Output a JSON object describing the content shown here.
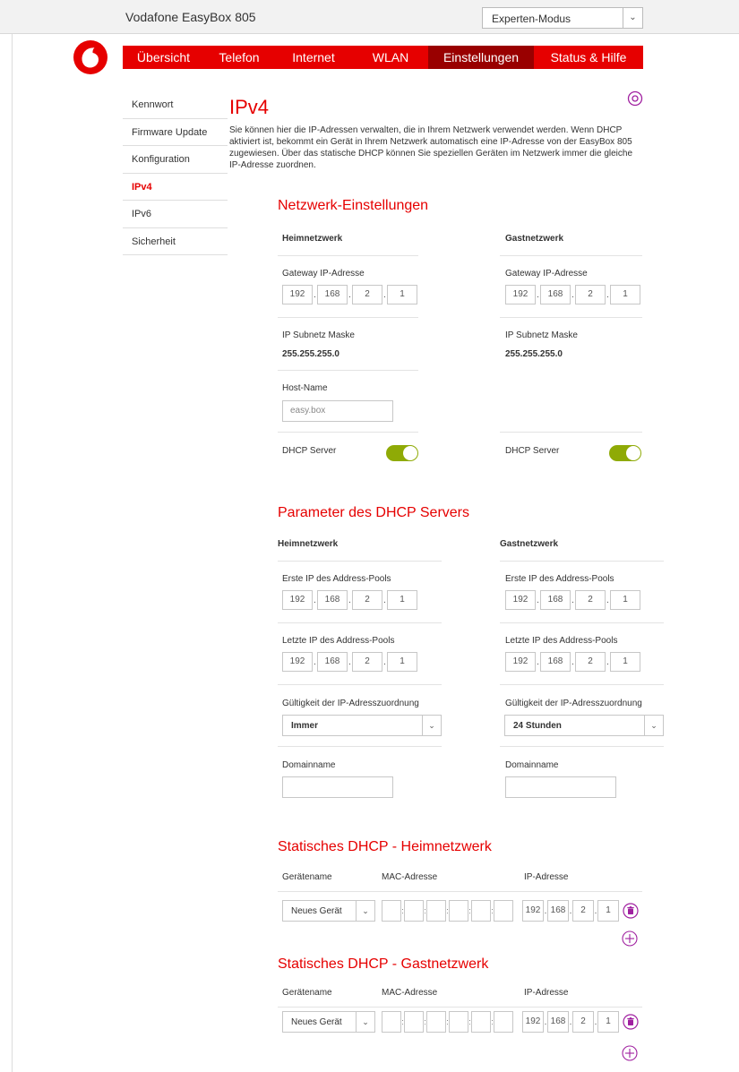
{
  "app": {
    "title": "Vodafone EasyBox 805"
  },
  "mode": {
    "selected": "Experten-Modus"
  },
  "colors": {
    "brand": "#e60000",
    "nav_active": "#990000",
    "toggle_on": "#8faa06",
    "accent_icon": "#a020a0"
  },
  "nav": {
    "items": [
      {
        "label": "Übersicht"
      },
      {
        "label": "Telefon"
      },
      {
        "label": "Internet"
      },
      {
        "label": "WLAN"
      },
      {
        "label": "Einstellungen",
        "active": true
      },
      {
        "label": "Status & Hilfe"
      }
    ]
  },
  "sidebar": {
    "items": [
      {
        "label": "Kennwort"
      },
      {
        "label": "Firmware Update"
      },
      {
        "label": "Konfiguration"
      },
      {
        "label": "IPv4",
        "active": true
      },
      {
        "label": "IPv6"
      },
      {
        "label": "Sicherheit"
      }
    ]
  },
  "page": {
    "title": "IPv4",
    "intro": "Sie können hier die IP-Adressen verwalten, die in Ihrem Netzwerk verwendet werden. Wenn DHCP aktiviert ist, bekommt ein Gerät in Ihrem Netzwerk automatisch eine IP-Adresse von der EasyBox 805 zugewiesen. Über das statische DHCP können Sie speziellen Geräten im Netzwerk immer die gleiche IP-Adresse zuordnen."
  },
  "network": {
    "title": "Netzwerk-Einstellungen",
    "home": {
      "heading": "Heimnetzwerk",
      "gateway_label": "Gateway IP-Adresse",
      "gateway_ip": [
        "192",
        "168",
        "2",
        "1"
      ],
      "subnet_label": "IP Subnetz Maske",
      "subnet_value": "255.255.255.0",
      "host_label": "Host-Name",
      "host_placeholder": "easy.box",
      "dhcp_label": "DHCP Server",
      "dhcp_on": true
    },
    "guest": {
      "heading": "Gastnetzwerk",
      "gateway_label": "Gateway IP-Adresse",
      "gateway_ip": [
        "192",
        "168",
        "2",
        "1"
      ],
      "subnet_label": "IP Subnetz Maske",
      "subnet_value": "255.255.255.0",
      "dhcp_label": "DHCP Server",
      "dhcp_on": true
    }
  },
  "dhcp": {
    "title": "Parameter des DHCP Servers",
    "home": {
      "heading": "Heimnetzwerk",
      "first_label": "Erste IP des Address-Pools",
      "first_ip": [
        "192",
        "168",
        "2",
        "1"
      ],
      "last_label": "Letzte IP des Address-Pools",
      "last_ip": [
        "192",
        "168",
        "2",
        "1"
      ],
      "lease_label": "Gültigkeit der IP-Adresszuordnung",
      "lease_value": "Immer",
      "domain_label": "Domainname",
      "domain_value": ""
    },
    "guest": {
      "heading": "Gastnetzwerk",
      "first_label": "Erste IP des Address-Pools",
      "first_ip": [
        "192",
        "168",
        "2",
        "1"
      ],
      "last_label": "Letzte IP des Address-Pools",
      "last_ip": [
        "192",
        "168",
        "2",
        "1"
      ],
      "lease_label": "Gültigkeit der IP-Adresszuordnung",
      "lease_value": "24 Stunden",
      "domain_label": "Domainname",
      "domain_value": ""
    }
  },
  "static_home": {
    "title": "Statisches DHCP - Heimnetzwerk",
    "col_device": "Gerätename",
    "col_mac": "MAC-Adresse",
    "col_ip": "IP-Adresse",
    "device": "Neues Gerät",
    "ip": [
      "192",
      "168",
      "2",
      "1"
    ]
  },
  "static_guest": {
    "title": "Statisches DHCP - Gastnetzwerk",
    "col_device": "Gerätename",
    "col_mac": "MAC-Adresse",
    "col_ip": "IP-Adresse",
    "device": "Neues Gerät",
    "ip": [
      "192",
      "168",
      "2",
      "1"
    ]
  }
}
